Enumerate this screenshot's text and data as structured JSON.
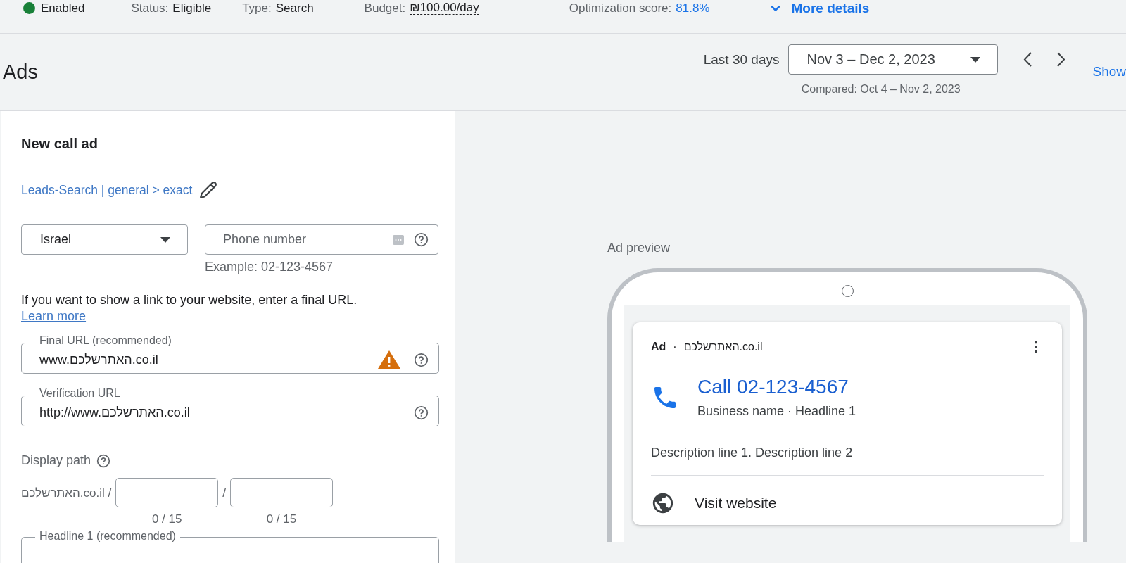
{
  "campaign_bar": {
    "status": {
      "label": "Enabled",
      "on": true
    },
    "items": [
      {
        "kind": "plain",
        "label": "Status:",
        "value": "Eligible"
      },
      {
        "kind": "plain",
        "label": "Type:",
        "value": "Search"
      },
      {
        "kind": "dashed",
        "label": "Budget:",
        "value": "₪100.00/day"
      },
      {
        "kind": "score",
        "label": "Optimization score:",
        "value": "81.8%"
      }
    ],
    "more_details": "More details"
  },
  "header": {
    "title": "Ads",
    "range_label": "Last 30 days",
    "date_range": "Nov 3 – Dec 2, 2023",
    "compared": "Compared: Oct 4 – Nov 2, 2023",
    "show_button": "Show"
  },
  "form": {
    "title": "New call ad",
    "ad_group_link": "Leads-Search | general > exact",
    "country": "Israel",
    "phone": {
      "placeholder": "Phone number",
      "hint": "Example: 02-123-4567"
    },
    "url_info": "If you want to show a link to your website, enter a final URL.",
    "learn_more": "Learn more",
    "url_fields": [
      {
        "label": "Final URL (recommended)",
        "value": "www.האתרשלכם.co.il",
        "warning": true
      },
      {
        "label": "Verification URL",
        "value": "http://www.האתרשלכם.co.il",
        "warning": false
      }
    ],
    "display_path": {
      "label": "Display path",
      "domain": "האתרשלכם.co.il /",
      "separator": "/",
      "counters": [
        "0 / 15",
        "0 / 15"
      ]
    },
    "headline_label": "Headline 1 (recommended)"
  },
  "preview": {
    "title": "Ad preview",
    "ad_label": "Ad",
    "separator": "·",
    "domain": "האתרשלכם.co.il",
    "call_text": "Call 02-123-4567",
    "subtitle": "Business name · Headline 1",
    "description": "Description line 1. Description line 2",
    "visit": "Visit website"
  }
}
